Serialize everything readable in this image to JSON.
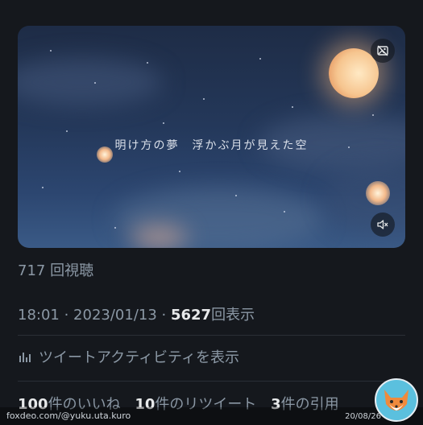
{
  "video": {
    "caption": "明け方の夢　浮かぶ月が見えた空",
    "views_text": "717 回視聴",
    "top_button_icon": "picture-off-icon",
    "mute_icon": "speaker-muted-icon"
  },
  "meta": {
    "time": "18:01",
    "separator": " · ",
    "date": "2023/01/13",
    "impressions": "5627",
    "impressions_suffix": "回表示"
  },
  "activity": {
    "icon": "bar-chart-icon",
    "label": "ツイートアクティビティを表示"
  },
  "counts": {
    "likes_num": "100",
    "likes_label": "件のいいね",
    "retweets_num": "10",
    "retweets_label": "件のリツイート",
    "quotes_num": "3",
    "quotes_label": "件の引用"
  },
  "watermark": {
    "left": "foxdeo.com/@yuku.uta.kuro",
    "right": "20/08/26",
    "logo_icon": "fox-logo-icon"
  },
  "colors": {
    "background": "#15181d",
    "muted_text": "#8b98a5",
    "strong_text": "#e7e9ea"
  }
}
